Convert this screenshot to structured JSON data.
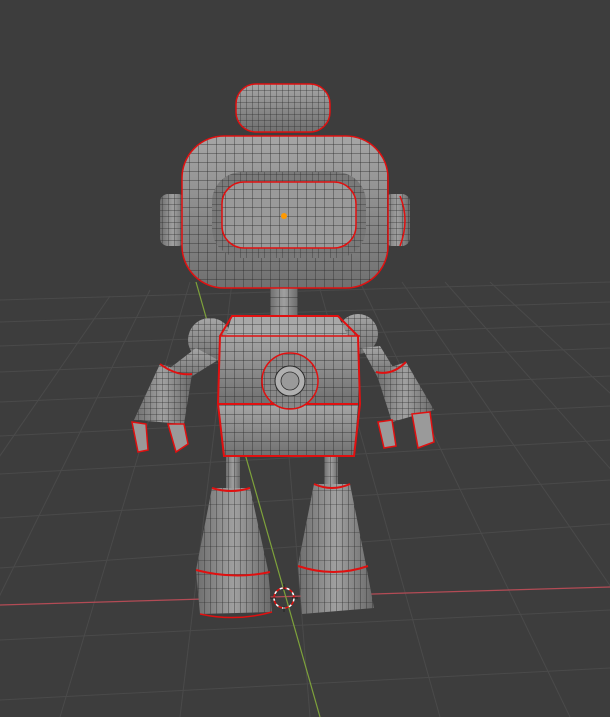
{
  "viewport": {
    "background": "#3d3d3d",
    "grid_color": "#4a4a4a",
    "x_axis_color": "#b34b55",
    "y_axis_color": "#7ea23b",
    "seam_color": "#e01010",
    "mesh_fill": "#8f8f8f",
    "wire_color": "#2a2a2a",
    "origin_color": "#ff9900"
  },
  "scene": {
    "object": "robot-mesh",
    "mode": "edit-wireframe-with-seams"
  }
}
